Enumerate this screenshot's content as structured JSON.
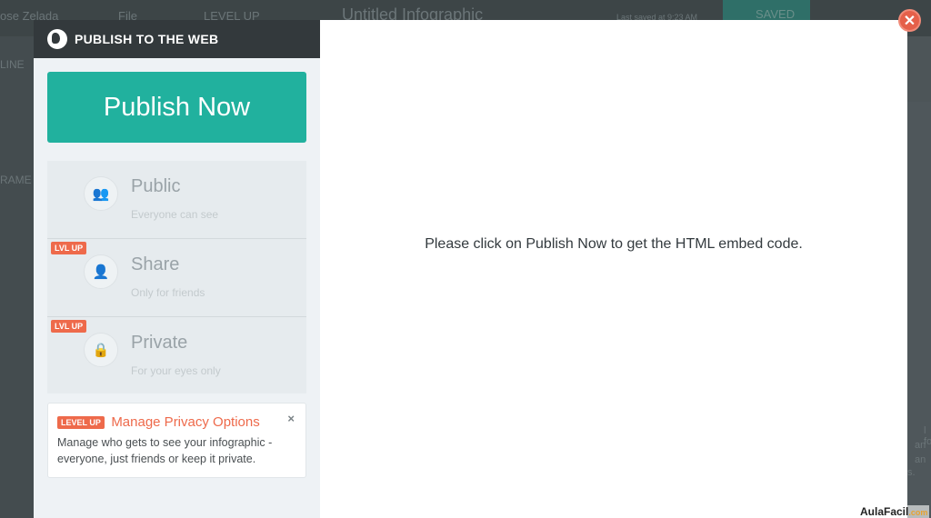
{
  "topbar": {
    "user": "ose Zelada",
    "file": "File",
    "levelup": "LEVEL UP",
    "doc_title": "Untitled Infographic",
    "last_saved": "Last saved at 9:23 AM",
    "saved": "SAVED"
  },
  "background": {
    "left_labels": [
      "LINE",
      "RAME"
    ],
    "right_text": [
      "l for",
      "an",
      "an",
      "s."
    ]
  },
  "modal": {
    "header": "PUBLISH TO THE WEB",
    "publish_button": "Publish Now",
    "options": [
      {
        "title": "Public",
        "subtitle": "Everyone can see",
        "icon": "group-icon",
        "badge": ""
      },
      {
        "title": "Share",
        "subtitle": "Only for friends",
        "icon": "user-share-icon",
        "badge": "LVL UP"
      },
      {
        "title": "Private",
        "subtitle": "For your eyes only",
        "icon": "lock-icon",
        "badge": "LVL UP"
      }
    ],
    "privacy_card": {
      "badge": "LEVEL UP",
      "title": "Manage Privacy Options",
      "text": "Manage who gets to see your infographic - everyone, just friends or keep it private.",
      "close": "×"
    },
    "message": "Please click on Publish Now to get the HTML embed code.",
    "close": "✕"
  },
  "watermark": {
    "name": "AulaFacil",
    "suffix": ".com"
  },
  "colors": {
    "accent": "#21b19e",
    "levelup": "#ee6a4b",
    "close": "#e5604a"
  }
}
